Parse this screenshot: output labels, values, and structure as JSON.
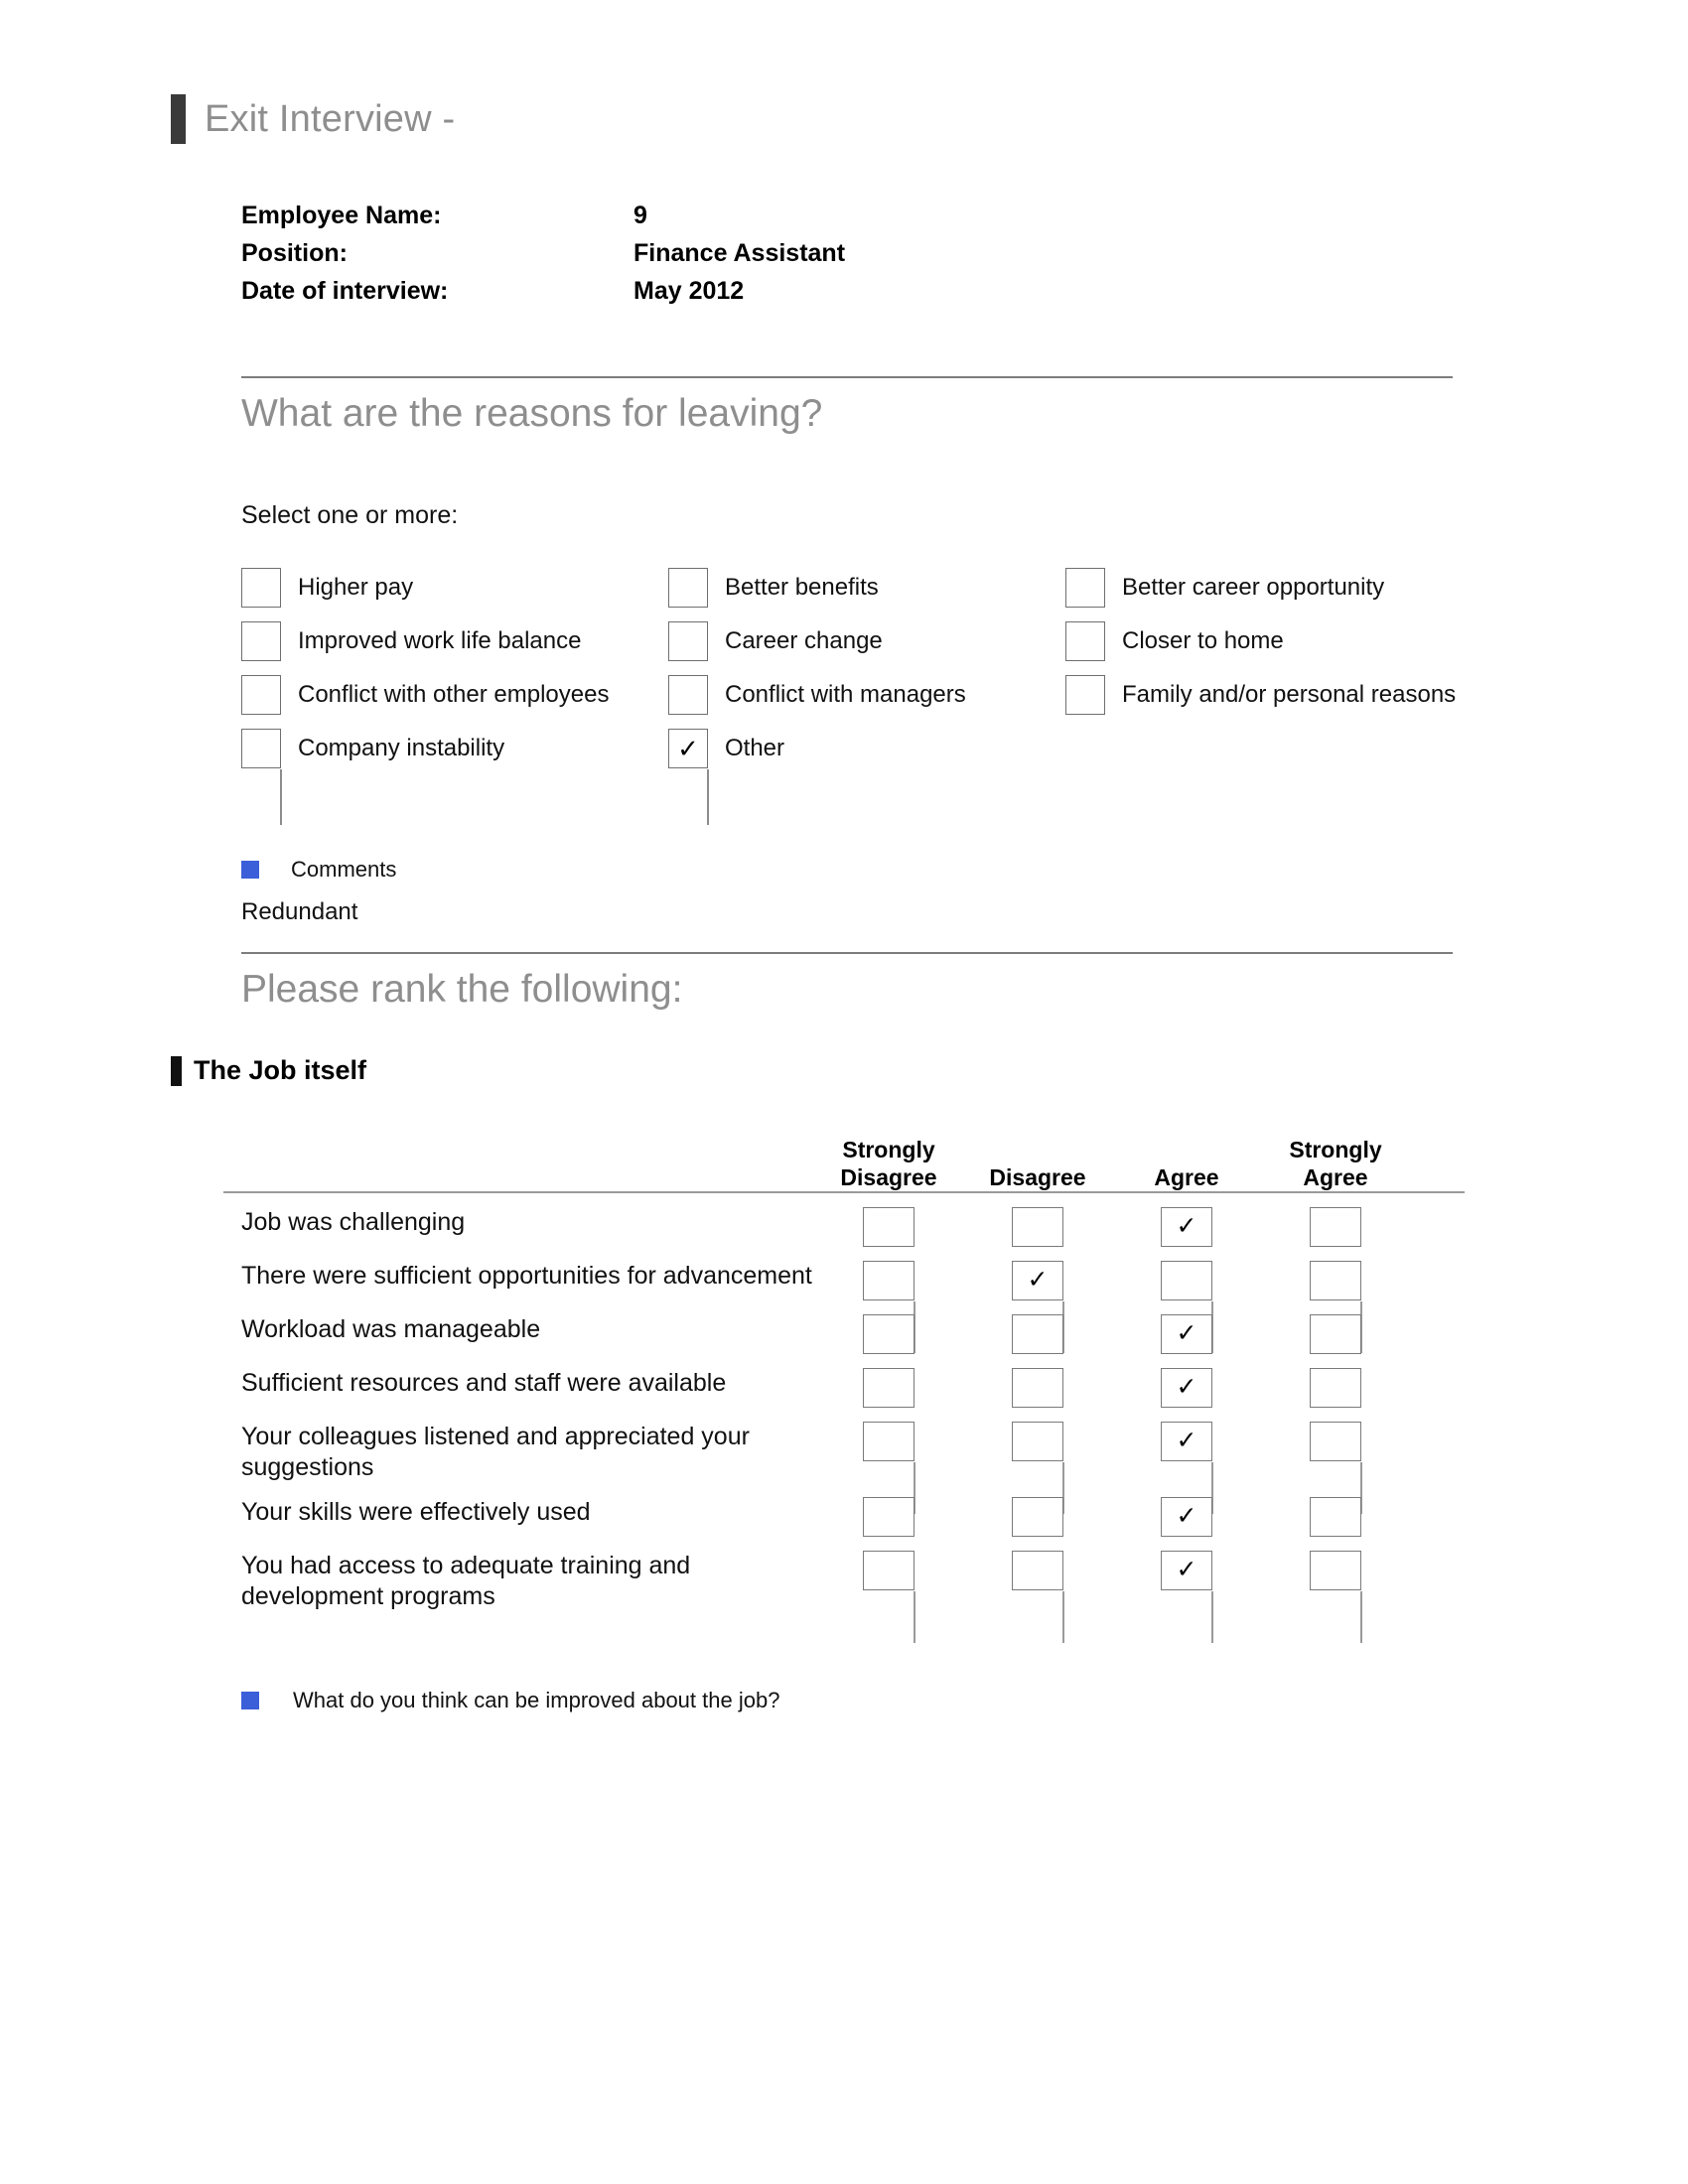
{
  "document": {
    "title": "Exit Interview -"
  },
  "meta": {
    "rows": [
      {
        "label": "Employee Name:",
        "value": "9"
      },
      {
        "label": "Position:",
        "value": "Finance Assistant"
      },
      {
        "label": "Date of interview:",
        "value": "May 2012"
      }
    ]
  },
  "reasons_section": {
    "heading": "What are the reasons for leaving?",
    "instruction": "Select one or more:",
    "options": [
      {
        "label": "Higher pay",
        "checked": false
      },
      {
        "label": "Better benefits",
        "checked": false
      },
      {
        "label": "Better career opportunity",
        "checked": false
      },
      {
        "label": "Improved work life balance",
        "checked": false
      },
      {
        "label": "Career change",
        "checked": false
      },
      {
        "label": "Closer to home",
        "checked": false
      },
      {
        "label": "Conflict with other employees",
        "checked": false
      },
      {
        "label": "Conflict with managers",
        "checked": false
      },
      {
        "label": "Family and/or personal reasons",
        "checked": false
      },
      {
        "label": "Company instability",
        "checked": false
      },
      {
        "label": "Other",
        "checked": true
      }
    ],
    "comments_label": "Comments",
    "comments_value": "Redundant"
  },
  "rank_section": {
    "heading": "Please rank the following:",
    "subheading": "The Job itself",
    "columns": [
      "Strongly\nDisagree",
      "Disagree",
      "Agree",
      "Strongly\nAgree"
    ],
    "rows": [
      {
        "label": "Job was challenging",
        "selected": 2
      },
      {
        "label": "There were sufficient opportunities for advancement",
        "selected": 1
      },
      {
        "label": "Workload was manageable",
        "selected": 2
      },
      {
        "label": "Sufficient resources and staff were available",
        "selected": 2
      },
      {
        "label": "Your colleagues listened and appreciated your suggestions",
        "selected": 2
      },
      {
        "label": "Your skills were effectively used",
        "selected": 2
      },
      {
        "label": "You had access to adequate training and development programs",
        "selected": 2
      }
    ],
    "followup_question": "What do you think can be improved about the job?"
  },
  "glyphs": {
    "tick": "✓"
  },
  "colors": {
    "bullet": "#3b5fd9",
    "heading": "#8e8e8e",
    "marker": "#3a3a3a"
  }
}
